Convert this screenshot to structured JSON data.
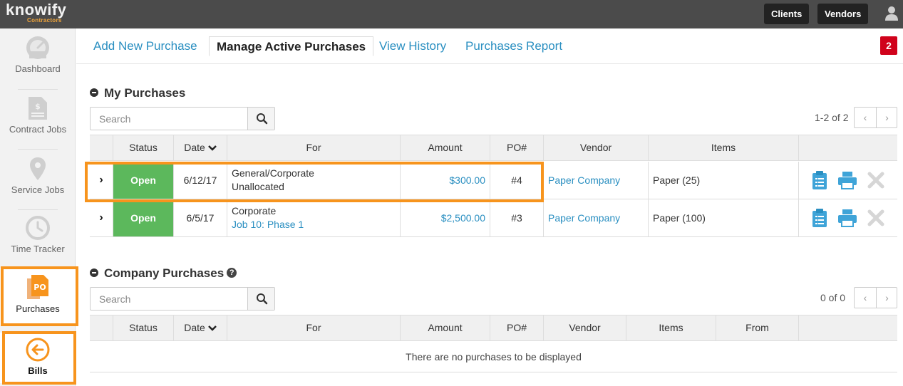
{
  "app": {
    "brand": "knowify",
    "sub_brand": "Contractors"
  },
  "header": {
    "clients_label": "Clients",
    "vendors_label": "Vendors"
  },
  "sidebar": {
    "items": [
      {
        "label": "Dashboard",
        "icon": "dashboard-icon"
      },
      {
        "label": "Contract Jobs",
        "icon": "contract-document-icon"
      },
      {
        "label": "Service Jobs",
        "icon": "map-pin-icon"
      },
      {
        "label": "Time Tracker",
        "icon": "clock-icon"
      },
      {
        "label": "Purchases",
        "icon": "po-document-icon",
        "badge": "PO"
      },
      {
        "label": "Bills",
        "icon": "arrow-left-circle-icon"
      }
    ]
  },
  "tabs": [
    {
      "label": "Add New Purchase"
    },
    {
      "label": "Manage Active Purchases"
    },
    {
      "label": "View History"
    },
    {
      "label": "Purchases Report"
    }
  ],
  "notification_count": "2",
  "my_purchases": {
    "title": "My Purchases",
    "search_placeholder": "Search",
    "pager_text": "1-2 of 2",
    "columns": [
      "Status",
      "Date",
      "For",
      "Amount",
      "PO#",
      "Vendor",
      "Items"
    ],
    "rows": [
      {
        "status": "Open",
        "date": "6/12/17",
        "for_line1": "General/Corporate",
        "for_line2": "Unallocated",
        "amount": "$300.00",
        "po": "#4",
        "vendor": "Paper Company",
        "items": "Paper (25)"
      },
      {
        "status": "Open",
        "date": "6/5/17",
        "for_line1": "Corporate",
        "for_line2": "Job 10: Phase 1",
        "amount": "$2,500.00",
        "po": "#3",
        "vendor": "Paper Company",
        "items": "Paper (100)"
      }
    ]
  },
  "company_purchases": {
    "title": "Company Purchases",
    "search_placeholder": "Search",
    "pager_text": "0 of 0",
    "columns": [
      "Status",
      "Date",
      "For",
      "Amount",
      "PO#",
      "Vendor",
      "Items",
      "From"
    ],
    "empty_message": "There are no purchases to be displayed"
  },
  "colors": {
    "accent": "#2a8fc1",
    "open_status": "#5cb85c",
    "highlight": "#f7941d",
    "badge": "#d0021b"
  }
}
